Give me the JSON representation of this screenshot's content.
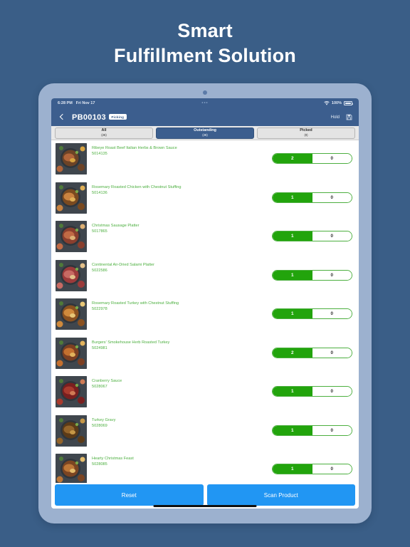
{
  "promo": {
    "line1": "Smart",
    "line2": "Fulfillment Solution"
  },
  "colors": {
    "background": "#3a5e87",
    "device_frame": "#9cb1cf",
    "nav_blue": "#3c5e8e",
    "accent_green": "#22a40c",
    "text_green": "#4caf3f",
    "action_blue": "#2196f3"
  },
  "status_bar": {
    "time": "6:28 PM",
    "date": "Fri Nov 17",
    "center_dots": "•••",
    "battery_percent": "100%",
    "wifi_icon": "wifi-icon",
    "battery_icon": "battery-icon"
  },
  "navbar": {
    "back_icon": "chevron-left-icon",
    "order_number": "PB00103",
    "status_badge": "Picking",
    "hold_label": "Hold",
    "save_icon": "save-icon"
  },
  "tabs": [
    {
      "label": "All",
      "count": "(26)",
      "active": false
    },
    {
      "label": "Outstanding",
      "count": "(26)",
      "active": true
    },
    {
      "label": "Picked",
      "count": "(0)",
      "active": false
    }
  ],
  "products": [
    {
      "name": "Ribeye Roast Beef Italian Herbs & Brown Sauce",
      "sku": "5014135",
      "required": "2",
      "picked": "0"
    },
    {
      "name": "Rosemary Roasted Chicken with Chestnut Stuffing",
      "sku": "5014136",
      "required": "1",
      "picked": "0"
    },
    {
      "name": "Christmas Sausage Platter",
      "sku": "5017865",
      "required": "1",
      "picked": "0"
    },
    {
      "name": "Continental Air-Dried Salami Platter",
      "sku": "5022586",
      "required": "1",
      "picked": "0"
    },
    {
      "name": "Rosemary Roasted Turkey with Chestnut Stuffing",
      "sku": "5022978",
      "required": "1",
      "picked": "0"
    },
    {
      "name": "Burgers' Smokehouse Herb Roasted Turkey",
      "sku": "5024981",
      "required": "2",
      "picked": "0"
    },
    {
      "name": "Cranberry Sauce",
      "sku": "5028067",
      "required": "1",
      "picked": "0"
    },
    {
      "name": "Turkey Gravy",
      "sku": "5028069",
      "required": "1",
      "picked": "0"
    },
    {
      "name": "Hearty Christmas Feast",
      "sku": "5028085",
      "required": "1",
      "picked": "0"
    }
  ],
  "actions": {
    "reset_label": "Reset",
    "scan_label": "Scan Product"
  }
}
